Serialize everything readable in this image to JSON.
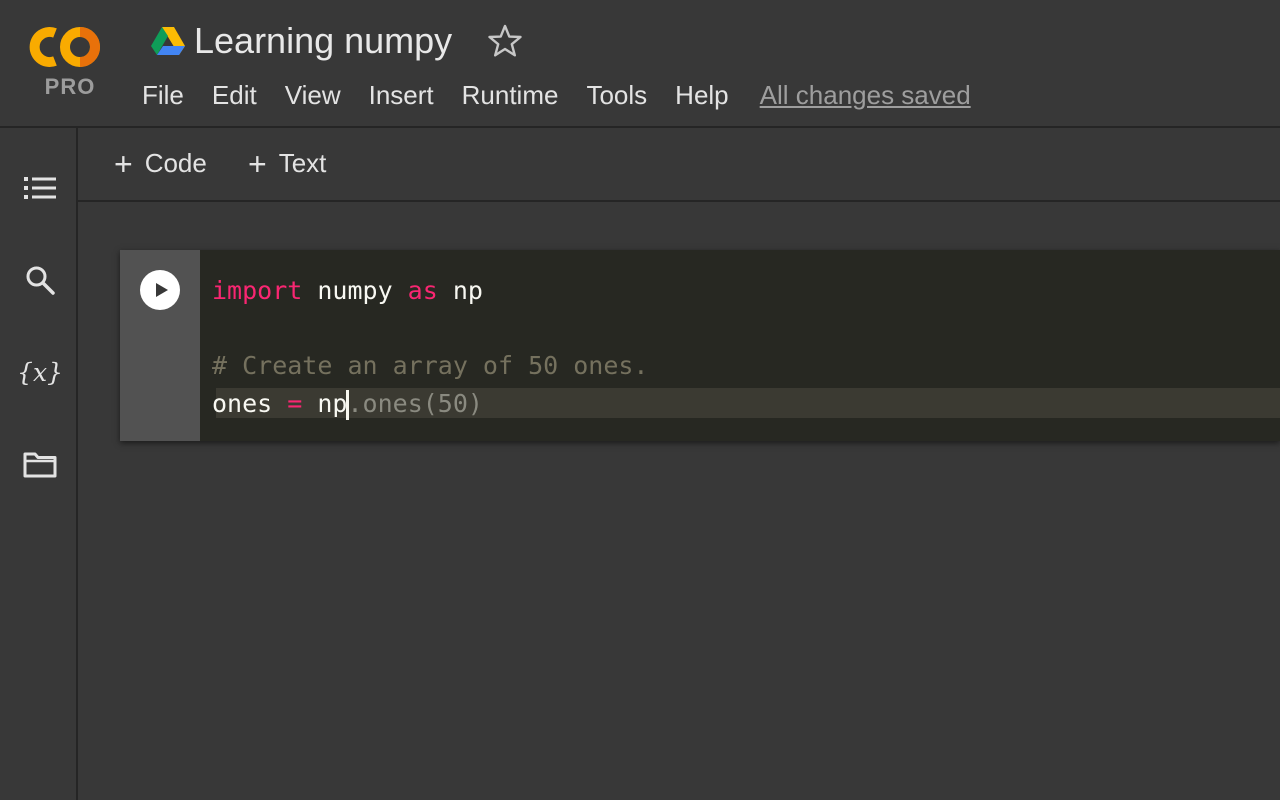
{
  "app": {
    "pro_label": "PRO",
    "title": "Learning numpy",
    "colors": {
      "logo_orange": "#F9AB00",
      "logo_dark_orange": "#E8710A",
      "background": "#383838",
      "editor_bg": "#272822",
      "keyword": "#F92672",
      "comment": "#75715E"
    }
  },
  "menu": {
    "items": [
      "File",
      "Edit",
      "View",
      "Insert",
      "Runtime",
      "Tools",
      "Help"
    ],
    "save_status": "All changes saved"
  },
  "sidebar": {
    "icons": [
      "table-of-contents-icon",
      "search-icon",
      "variables-icon",
      "folder-icon"
    ],
    "variables_glyph": "{𝑥}"
  },
  "toolbar": {
    "add_code_label": "Code",
    "add_text_label": "Text",
    "plus_glyph": "+"
  },
  "cell": {
    "line1": {
      "kw1": "import",
      "mid": " numpy ",
      "kw2": "as",
      "end": " np"
    },
    "line3": "# Create an array of 50 ones.",
    "line4": {
      "lhs": "ones ",
      "op": "=",
      "typed": " np",
      "suggestion": ".ones(50)"
    }
  }
}
